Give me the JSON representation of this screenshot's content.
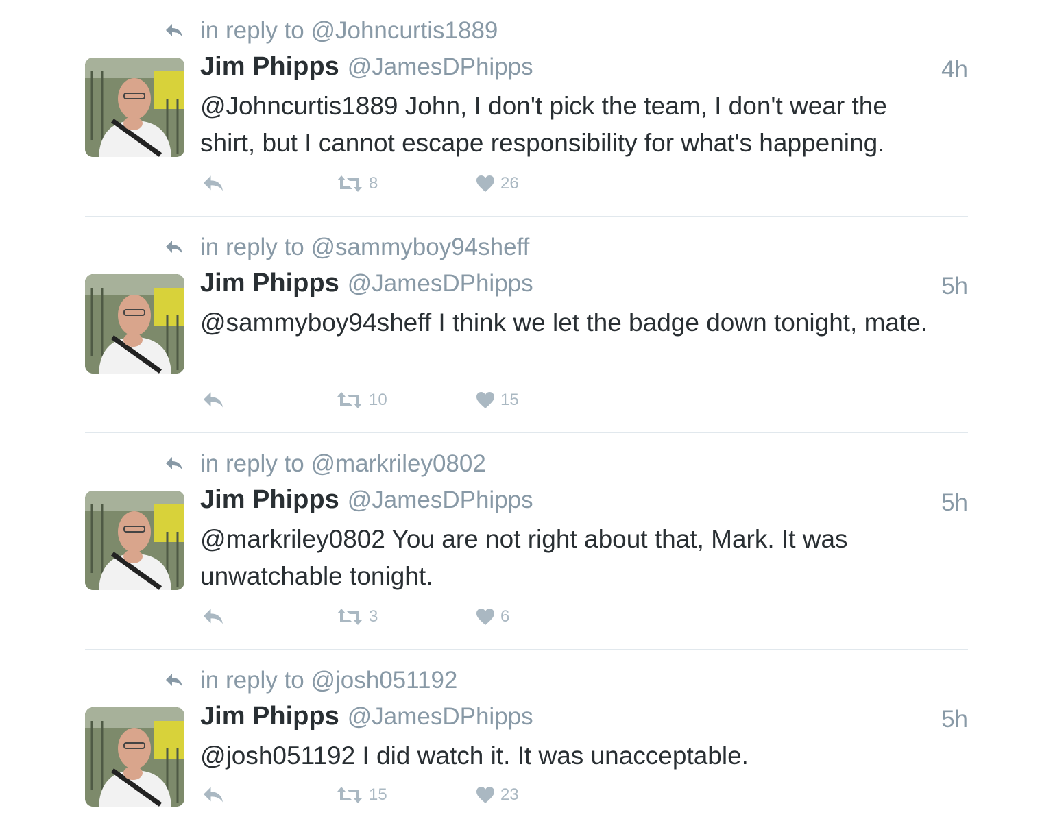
{
  "tweets": [
    {
      "reply_to": "in reply to @Johncurtis1889",
      "name": "Jim Phipps",
      "handle": "@JamesDPhipps",
      "time": "4h",
      "text": "@Johncurtis1889 John, I don't pick the team, I don't wear the shirt, but I cannot escape responsibility for what's happening.",
      "retweets": "8",
      "likes": "26"
    },
    {
      "reply_to": "in reply to @sammyboy94sheff",
      "name": "Jim Phipps",
      "handle": "@JamesDPhipps",
      "time": "5h",
      "text": "@sammyboy94sheff I think we let the badge down tonight, mate.",
      "retweets": "10",
      "likes": "15"
    },
    {
      "reply_to": "in reply to @markriley0802",
      "name": "Jim Phipps",
      "handle": "@JamesDPhipps",
      "time": "5h",
      "text": "@markriley0802 You are not right about that, Mark. It was unwatchable tonight.",
      "retweets": "3",
      "likes": "6"
    },
    {
      "reply_to": "in reply to @josh051192",
      "name": "Jim Phipps",
      "handle": "@JamesDPhipps",
      "time": "5h",
      "text": "@josh051192 I did watch it. It was unacceptable.",
      "retweets": "15",
      "likes": "23"
    }
  ],
  "colors": {
    "text": "#292f33",
    "muted": "#8899a6",
    "action": "#aab8c2",
    "divider": "#e1e8ed"
  }
}
